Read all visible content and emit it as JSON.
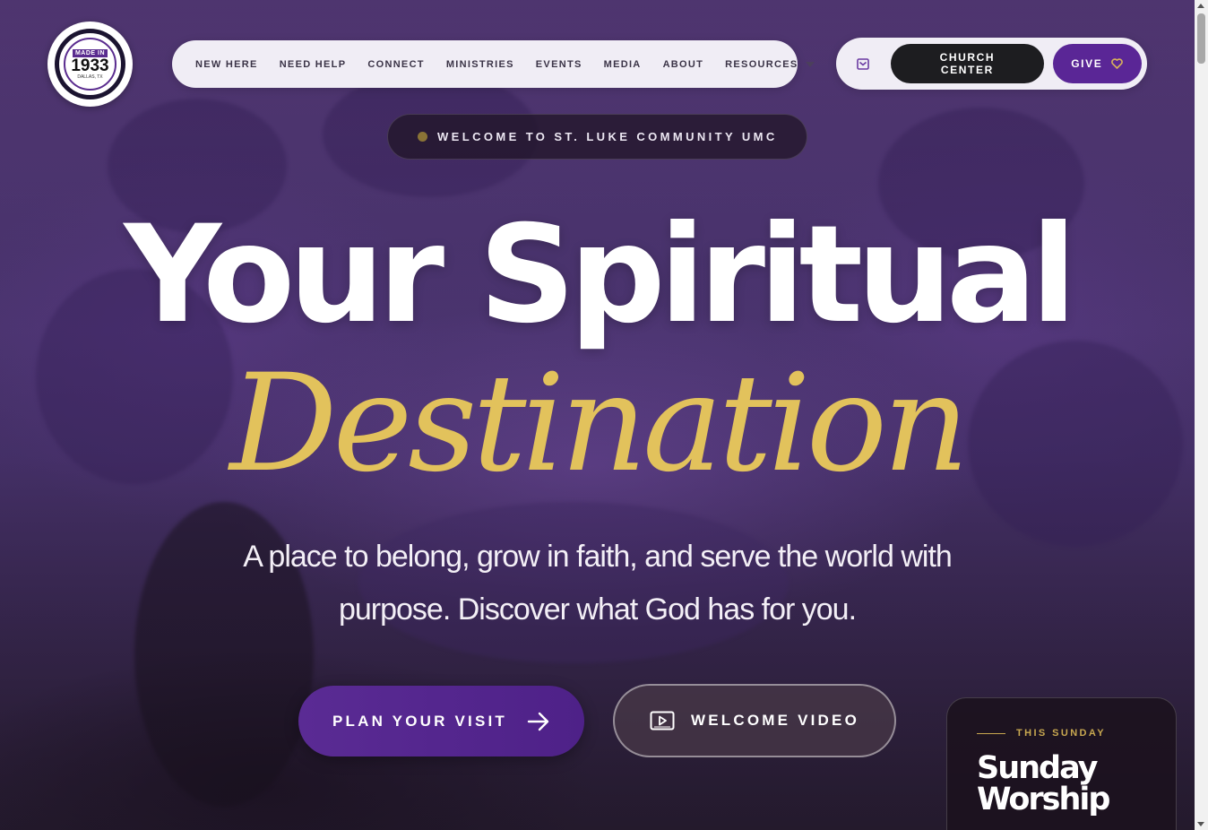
{
  "logo": {
    "badge": "MADE IN",
    "year": "1933",
    "city": "DALLAS, TX"
  },
  "nav": {
    "items": [
      {
        "label": "NEW HERE"
      },
      {
        "label": "NEED HELP"
      },
      {
        "label": "CONNECT"
      },
      {
        "label": "MINISTRIES"
      },
      {
        "label": "EVENTS"
      },
      {
        "label": "MEDIA"
      },
      {
        "label": "ABOUT"
      },
      {
        "label": "RESOURCES"
      }
    ]
  },
  "actions": {
    "mail_icon": "envelope-icon",
    "church_center": "CHURCH CENTER",
    "give": "GIVE",
    "give_icon": "heart-icon"
  },
  "hero": {
    "badge": "WELCOME TO ST. LUKE COMMUNITY UMC",
    "headline_1": "Your Spiritual",
    "headline_2": "Destination",
    "subtitle": "A place to belong, grow in faith, and serve the world with purpose. Discover what God has for you.",
    "plan_visit": "PLAN YOUR VISIT",
    "welcome_video": "WELCOME VIDEO"
  },
  "card": {
    "eyebrow": "THIS SUNDAY",
    "title": "Sunday Worship"
  },
  "colors": {
    "brand_purple": "#5a2696",
    "gold": "#e2c25c",
    "dark": "#1d1d20"
  }
}
